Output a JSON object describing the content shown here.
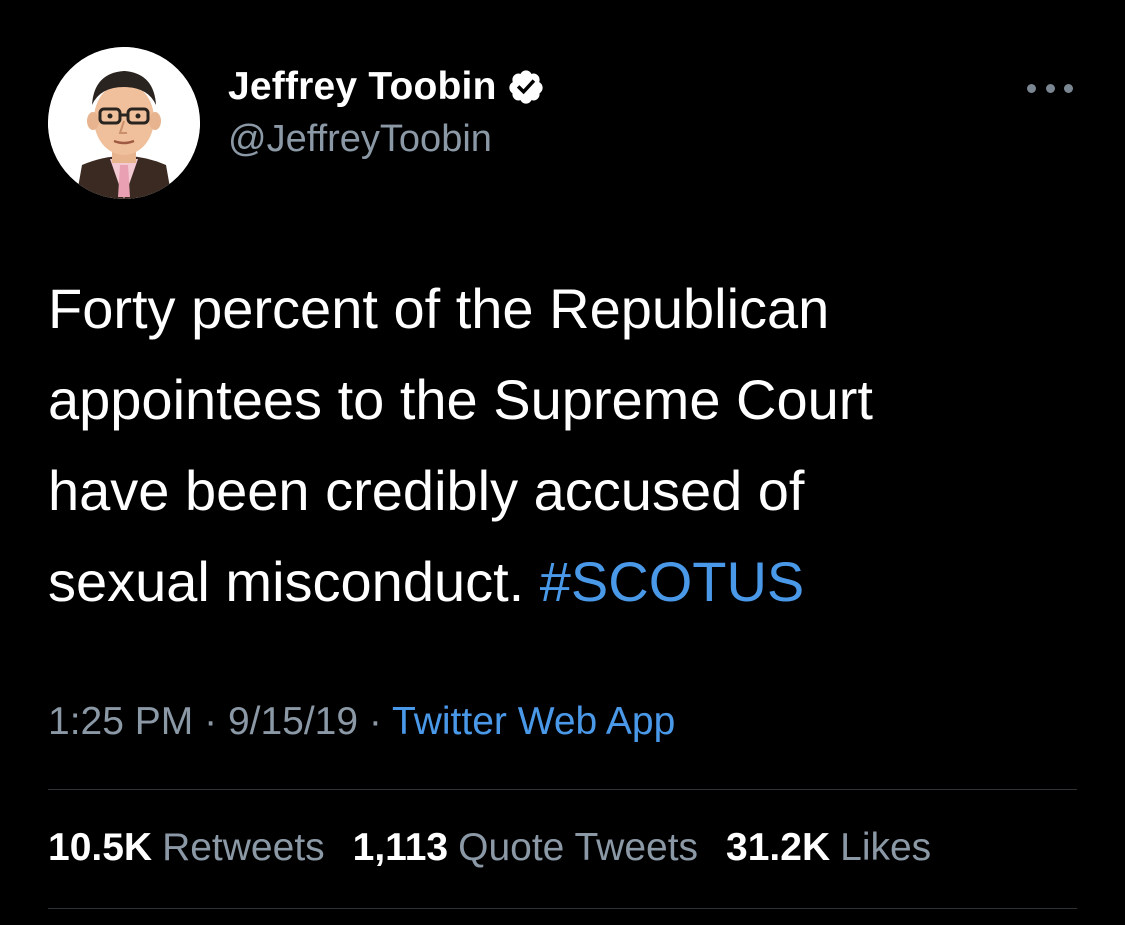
{
  "user": {
    "display_name": "Jeffrey Toobin",
    "handle": "@JeffreyToobin",
    "verified": true
  },
  "tweet": {
    "text_lines": [
      "Forty percent of the Republican",
      "appointees to the Supreme Court",
      "have been credibly accused of",
      "sexual misconduct."
    ],
    "hashtag": "#SCOTUS",
    "time": "1:25 PM",
    "separator": "·",
    "date": "9/15/19",
    "source": "Twitter Web App"
  },
  "stats": {
    "retweets_count": "10.5K",
    "retweets_label": "Retweets",
    "quotes_count": "1,113",
    "quotes_label": "Quote Tweets",
    "likes_count": "31.2K",
    "likes_label": "Likes"
  },
  "icons": {
    "more": "more-options-icon",
    "verified": "verified-badge-icon"
  },
  "colors": {
    "background": "#000000",
    "text": "#ffffff",
    "secondary": "#8b98a5",
    "link": "#4a99e9",
    "divider": "#2f3336"
  }
}
